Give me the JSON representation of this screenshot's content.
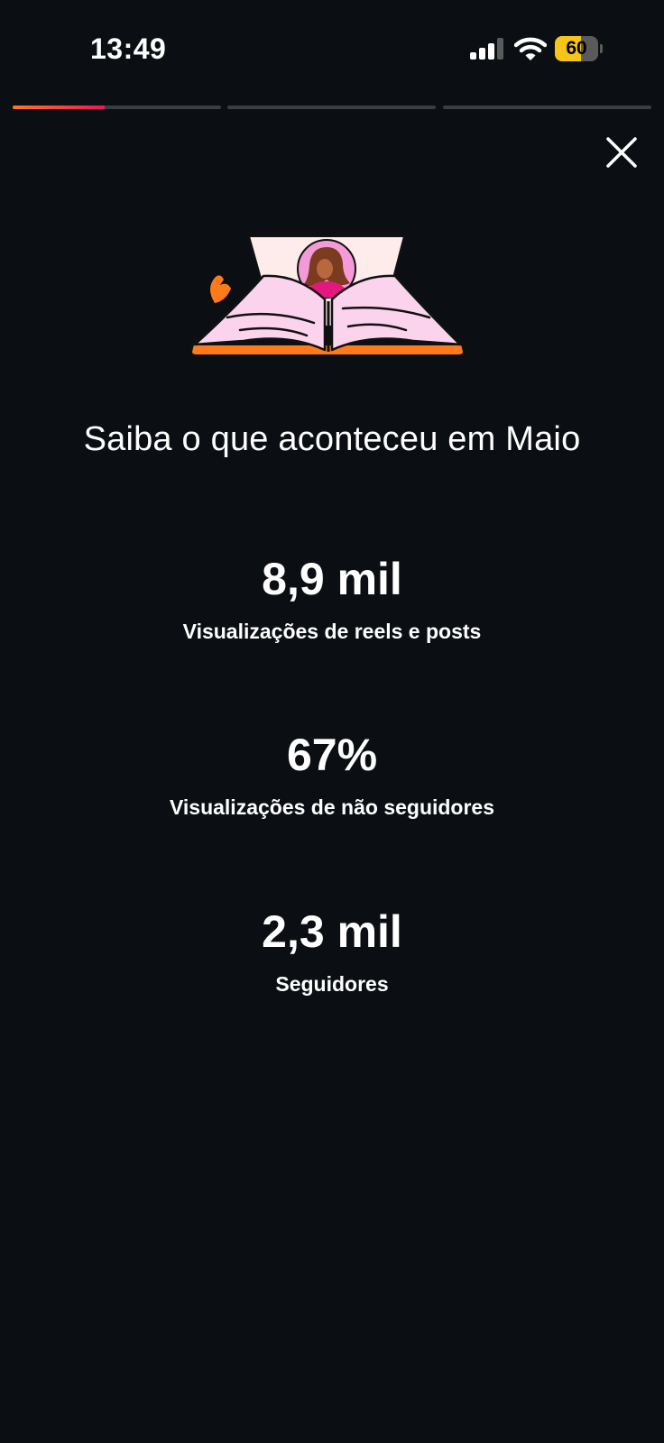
{
  "status_bar": {
    "time": "13:49",
    "battery_level": "60",
    "battery_fraction": 0.6,
    "signal_bars_active": 3,
    "icons": [
      "signal-icon",
      "wifi-icon",
      "battery-icon"
    ]
  },
  "story_progress": {
    "segments": 3,
    "current_segment": 1,
    "current_fill_fraction": 0.44
  },
  "close_icon": "close-icon",
  "illustration_icon": "open-book-icon",
  "headline": "Saiba o que aconteceu em Maio",
  "metrics": [
    {
      "value": "8,9 mil",
      "label": "Visualizações de reels e posts"
    },
    {
      "value": "67%",
      "label": "Visualizações de não seguidores"
    },
    {
      "value": "2,3 mil",
      "label": "Seguidores"
    }
  ],
  "colors": {
    "background": "#0b0f13",
    "accent_start": "#ff7a1a",
    "accent_end": "#e8175d",
    "battery_fill": "#f5c518"
  }
}
